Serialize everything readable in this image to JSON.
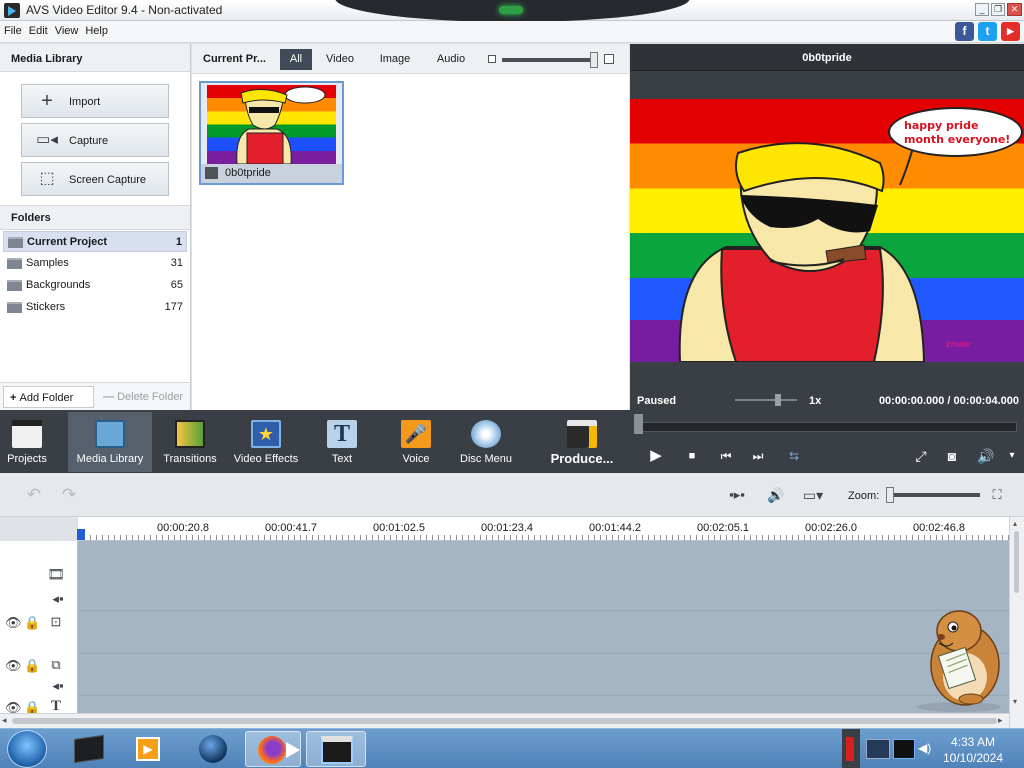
{
  "window": {
    "title": "AVS Video Editor 9.4 - Non-activated"
  },
  "menu": [
    "File",
    "Edit",
    "View",
    "Help"
  ],
  "social": {
    "facebook": "f",
    "twitter": "t",
    "youtube": "▶"
  },
  "media_library": {
    "header": "Media Library",
    "buttons": [
      {
        "label": "Import",
        "icon": "plus-icon"
      },
      {
        "label": "Capture",
        "icon": "camera-icon"
      },
      {
        "label": "Screen Capture",
        "icon": "screen-capture-icon"
      }
    ],
    "folders_header": "Folders",
    "folders": [
      {
        "name": "Current Project",
        "count": "1",
        "selected": true
      },
      {
        "name": "Samples",
        "count": "31"
      },
      {
        "name": "Backgrounds",
        "count": "65"
      },
      {
        "name": "Stickers",
        "count": "177"
      }
    ],
    "add_folder": "Add Folder",
    "delete_folder": "Delete Folder"
  },
  "content": {
    "title": "Current Pr...",
    "tabs": [
      "All",
      "Video",
      "Image",
      "Audio"
    ],
    "active_tab": "All",
    "items": [
      {
        "name": "0b0tpride"
      }
    ]
  },
  "preview": {
    "title": "0b0tpride",
    "bubble_text": "happy pride month everyone!",
    "signature": "zmaw",
    "status": "Paused",
    "speed": "1x",
    "timecode": "00:00:00.000  /  00:00:04.000"
  },
  "toolbar": {
    "tools": [
      {
        "label": "Projects",
        "icon": "projects-icon"
      },
      {
        "label": "Media Library",
        "icon": "media-library-icon",
        "active": true
      },
      {
        "label": "Transitions",
        "icon": "transitions-icon"
      },
      {
        "label": "Video Effects",
        "icon": "video-effects-icon"
      },
      {
        "label": "Text",
        "icon": "text-icon"
      },
      {
        "label": "Voice",
        "icon": "microphone-icon"
      },
      {
        "label": "Disc Menu",
        "icon": "disc-menu-icon"
      },
      {
        "label": "Produce...",
        "icon": "produce-icon"
      }
    ]
  },
  "timeline": {
    "zoom_label": "Zoom:",
    "ruler": [
      "00:00:20.8",
      "00:00:41.7",
      "00:01:02.5",
      "00:01:23.4",
      "00:01:44.2",
      "00:02:05.1",
      "00:02:26.0",
      "00:02:46.8"
    ]
  },
  "taskbar": {
    "time": "4:33 AM",
    "date": "10/10/2024"
  },
  "colors": {
    "dark_panel": "#3a3f45",
    "accent_blue": "#1f5fd6",
    "timeline_bg": "#a6b5c4"
  }
}
